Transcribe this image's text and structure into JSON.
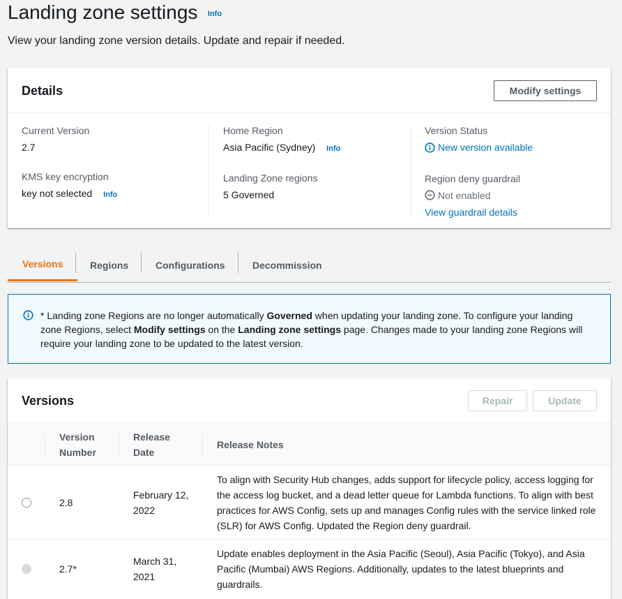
{
  "page": {
    "title": "Landing zone settings",
    "info": "Info",
    "description": "View your landing zone version details. Update and repair if needed."
  },
  "details": {
    "title": "Details",
    "modify_button": "Modify settings",
    "current_version_label": "Current Version",
    "current_version_value": "2.7",
    "kms_label": "KMS key encryption",
    "kms_value": "key not selected",
    "kms_info": "Info",
    "home_region_label": "Home Region",
    "home_region_value": "Asia Pacific (Sydney)",
    "home_region_info": "Info",
    "lz_regions_label": "Landing Zone regions",
    "lz_regions_value": "5 Governed",
    "version_status_label": "Version Status",
    "version_status_value": "New version available",
    "region_deny_label": "Region deny guardrail",
    "region_deny_value": "Not enabled",
    "guardrail_link": "View guardrail details"
  },
  "tabs": [
    "Versions",
    "Regions",
    "Configurations",
    "Decommission"
  ],
  "alert": {
    "p1": "* Landing zone Regions are no longer automatically ",
    "b1": "Governed",
    "p2": " when updating your landing zone. To configure your landing zone Regions, select ",
    "b2": "Modify settings",
    "p3": " on the ",
    "b3": "Landing zone settings",
    "p4": " page. Changes made to your landing zone Regions will require your landing zone to be updated to the latest version."
  },
  "versions": {
    "title": "Versions",
    "repair_button": "Repair",
    "update_button": "Update",
    "col_version_1": "Version",
    "col_version_2": "Number",
    "col_release_1": "Release",
    "col_release_2": "Date",
    "col_notes": "Release Notes",
    "rows": [
      {
        "version": "2.8",
        "date_1": "February 12,",
        "date_2": "2022",
        "notes": "To align with Security Hub changes, adds support for lifecycle policy, access logging for the access log bucket, and a dead letter queue for Lambda functions. To align with best practices for AWS Config, sets up and manages Config rules with the service linked role (SLR) for AWS Config. Updated the Region deny guardrail."
      },
      {
        "version": "2.7*",
        "date_1": "March 31,",
        "date_2": "2021",
        "notes": "Update enables deployment in the Asia Pacific (Seoul), Asia Pacific (Tokyo), and Asia Pacific (Mumbai) AWS Regions. Additionally, updates to the latest blueprints and guardrails."
      }
    ]
  },
  "colors": {
    "accent_orange": "#ec7211",
    "link_blue": "#0073bb",
    "info_bg": "#f1faff"
  }
}
